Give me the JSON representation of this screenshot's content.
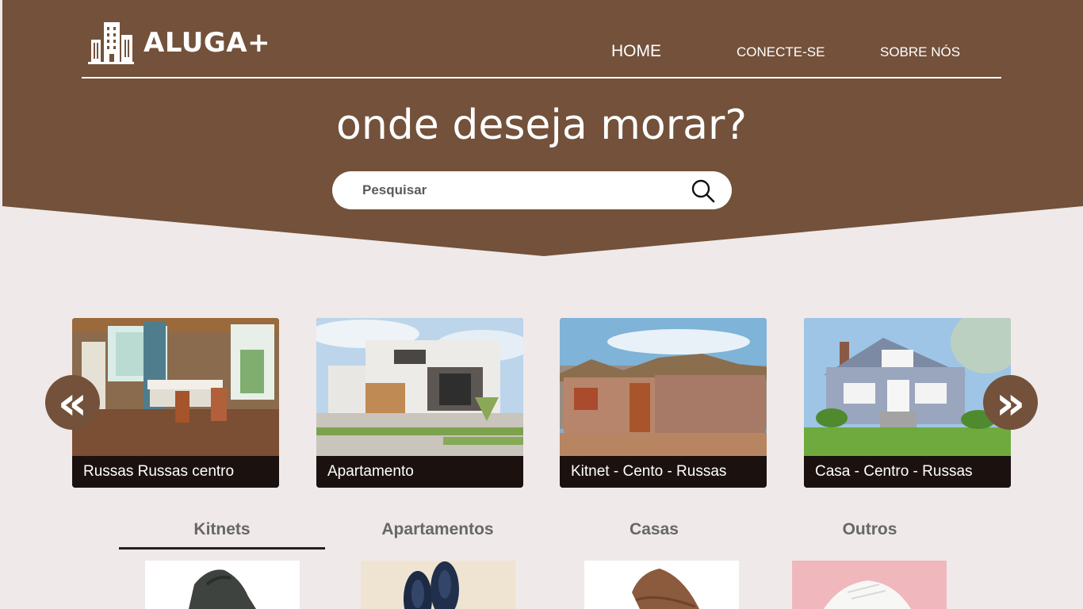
{
  "brand": {
    "name": "ALUGA+",
    "logo_icon": "buildings-icon"
  },
  "nav": {
    "home": "HOME",
    "connect": "CONECTE-SE",
    "about": "SOBRE NÓS"
  },
  "hero": {
    "headline": "onde deseja morar?"
  },
  "search": {
    "placeholder": "Pesquisar",
    "icon": "search-icon"
  },
  "carousel": {
    "prev_symbol": "«",
    "next_symbol": "»",
    "cards": [
      {
        "label": "Russas Russas centro",
        "image": "dining-room-photo"
      },
      {
        "label": "Apartamento",
        "image": "modern-house-photo"
      },
      {
        "label": "Kitnet - Cento - Russas",
        "image": "adobe-hut-photo"
      },
      {
        "label": "Casa - Centro - Russas",
        "image": "blue-house-photo"
      }
    ]
  },
  "categories": {
    "tabs": [
      "Kitnets",
      "Apartamentos",
      "Casas",
      "Outros"
    ],
    "active": "Kitnets"
  },
  "products": [
    "dark-sneaker-photo",
    "navy-shoes-photo",
    "brown-espadrille-photo",
    "white-sneaker-photo"
  ],
  "colors": {
    "brand_brown": "#73513a",
    "background": "#efe9e9",
    "card_caption": "#1b1210"
  }
}
